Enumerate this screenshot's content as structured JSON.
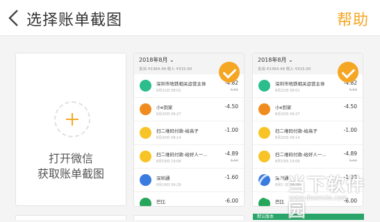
{
  "header": {
    "title": "选择账单截图",
    "help": "帮助"
  },
  "add_card": {
    "line1": "打开微信",
    "line2": "获取账单截图"
  },
  "colors": {
    "accent": "#f5a623"
  },
  "screenshots": [
    {
      "month": "2018年8月 ⌄",
      "summary": "支出 ¥1364.49 收入 ¥315.00",
      "rows": [
        {
          "icon": "metro-green-icon",
          "color": "#2bbd8c",
          "name": "深圳市地铁相关运营主体",
          "date": "8月21日 08:01",
          "amount": "-4.82",
          "sub": "5.50"
        },
        {
          "icon": "merchant-orange-icon",
          "color": "#f08c1e",
          "name": "小e到家",
          "date": "8月20日 09:27",
          "amount": "-4.50",
          "sub": ""
        },
        {
          "icon": "qr-user-icon",
          "color": "#f7c325",
          "name": "扫二维码付款-给高子",
          "date": "8月20日 08:14",
          "amount": "-1.00",
          "sub": ""
        },
        {
          "icon": "qr-user-icon",
          "color": "#f7c325",
          "name": "扫二维码付款-给好人一...",
          "date": "8月19日 19:08",
          "amount": "-4.89",
          "sub": "5.50"
        },
        {
          "icon": "shenzhentong-icon",
          "color": "#3a7be0",
          "name": "深圳通",
          "date": "8月19日 09:29",
          "amount": "-1.60",
          "sub": ""
        },
        {
          "icon": "bashi-icon",
          "color": "#26a65b",
          "name": "巴比",
          "date": "8月19日 07:57",
          "amount": "-6.00",
          "sub": ""
        }
      ]
    },
    {
      "month": "2018年8月 ⌄",
      "summary": "支出 ¥1364.49 收入 ¥315.00",
      "rows": [
        {
          "icon": "metro-green-icon",
          "color": "#2bbd8c",
          "name": "深圳市地铁相关运营主体",
          "date": "8月21日 08:01",
          "amount": "-4.82",
          "sub": "5.50"
        },
        {
          "icon": "merchant-orange-icon",
          "color": "#f08c1e",
          "name": "小e到家",
          "date": "8月20日 09:27",
          "amount": "-4.50",
          "sub": ""
        },
        {
          "icon": "qr-user-icon",
          "color": "#f7c325",
          "name": "扫二维码付款-给高子",
          "date": "8月20日 08:14",
          "amount": "-1.00",
          "sub": ""
        },
        {
          "icon": "qr-user-icon",
          "color": "#f7c325",
          "name": "扫二维码付款-给好人一...",
          "date": "8月19日 19:08",
          "amount": "-4.89",
          "sub": "5.50"
        },
        {
          "icon": "shenzhentong-icon",
          "color": "#3a7be0",
          "name": "深圳通",
          "date": "8月19日 09:29",
          "amount": "-1.60",
          "sub": ""
        },
        {
          "icon": "bashi-icon",
          "color": "#26a65b",
          "name": "巴比",
          "date": "8月19日 07:57",
          "amount": "-6.00",
          "sub": ""
        }
      ]
    }
  ],
  "bottom_label": "默认版本",
  "watermark": {
    "text": "当下软件园",
    "url": "www.downxia.com"
  }
}
